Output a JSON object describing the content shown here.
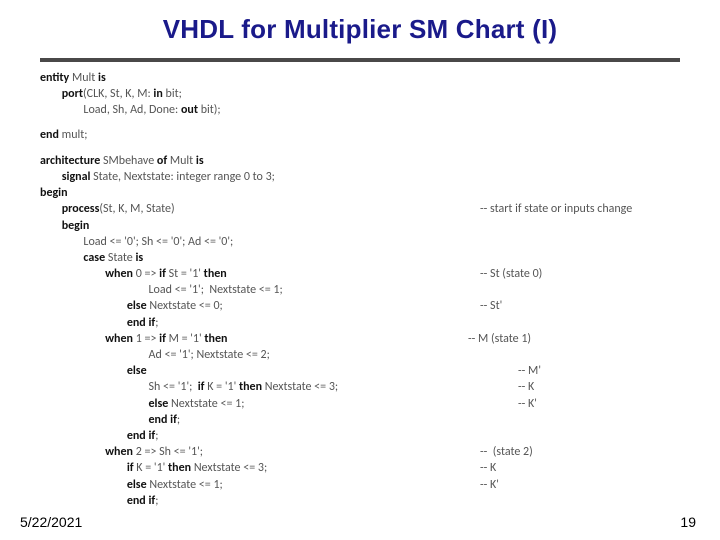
{
  "title": "VHDL for Multiplier SM Chart (I)",
  "footer": {
    "date": "5/22/2021",
    "page": "19"
  },
  "cmt": {
    "c1": "-- start if state or inputs change",
    "c2": "-- St (state 0)",
    "c3": "-- St'",
    "c4": "-- M (state 1)",
    "c5": "-- M'",
    "c6": "-- K",
    "c7": "-- K'",
    "c8": "--  (state 2)",
    "c9": "-- K",
    "c10": "-- K'"
  },
  "code": {
    "l1a": "entity ",
    "l1b": "Mult ",
    "l1c": "is",
    "l2a": "        port",
    "l2b": "(CLK, St, K, M: ",
    "l2c": "in ",
    "l2d": "bit;",
    "l3": "                Load, Sh, Ad, Done: ",
    "l3b": "out ",
    "l3c": "bit);",
    "l4": "end ",
    "l4b": "mult;",
    "l5a": "architecture ",
    "l5b": "SMbehave ",
    "l5c": "of ",
    "l5d": "Mult ",
    "l5e": "is",
    "l6a": "        signal ",
    "l6b": "State, Nextstate: integer range 0 to 3;",
    "l7": "begin",
    "l8a": "        process",
    "l8b": "(St, K, M, State)",
    "l9": "        begin",
    "l10": "                Load <= '0'; Sh <= '0'; Ad <= '0';",
    "l11a": "                case ",
    "l11b": "State ",
    "l11c": "is",
    "l12a": "                        when ",
    "l12b": "0 => ",
    "l12c": "if ",
    "l12d": "St = '1' ",
    "l12e": "then",
    "l13": "                                        Load <= '1';  Nextstate <= 1;",
    "l14a": "                                else ",
    "l14b": "Nextstate <= 0;",
    "l15a": "                                end if",
    "l15b": ";",
    "l16a": "                        when ",
    "l16b": "1 => ",
    "l16c": "if ",
    "l16d": "M = '1' ",
    "l16e": "then",
    "l17": "                                        Ad <= '1'; Nextstate <= 2;",
    "l18": "                                else",
    "l19a": "                                        Sh <= '1';  ",
    "l19b": "if ",
    "l19c": "K = '1' ",
    "l19d": "then ",
    "l19e": "Nextstate <= 3;",
    "l20a": "                                        else ",
    "l20b": "Nextstate <= 1;",
    "l21a": "                                        end if",
    "l21b": ";",
    "l22a": "                                end if",
    "l22b": ";",
    "l23a": "                        when ",
    "l23b": "2 => Sh <= '1';",
    "l24a": "                                if ",
    "l24b": "K = '1' ",
    "l24c": "then ",
    "l24d": "Nextstate <= 3;",
    "l25a": "                                else ",
    "l25b": "Nextstate <= 1;",
    "l26a": "                                end if",
    "l26b": ";"
  }
}
